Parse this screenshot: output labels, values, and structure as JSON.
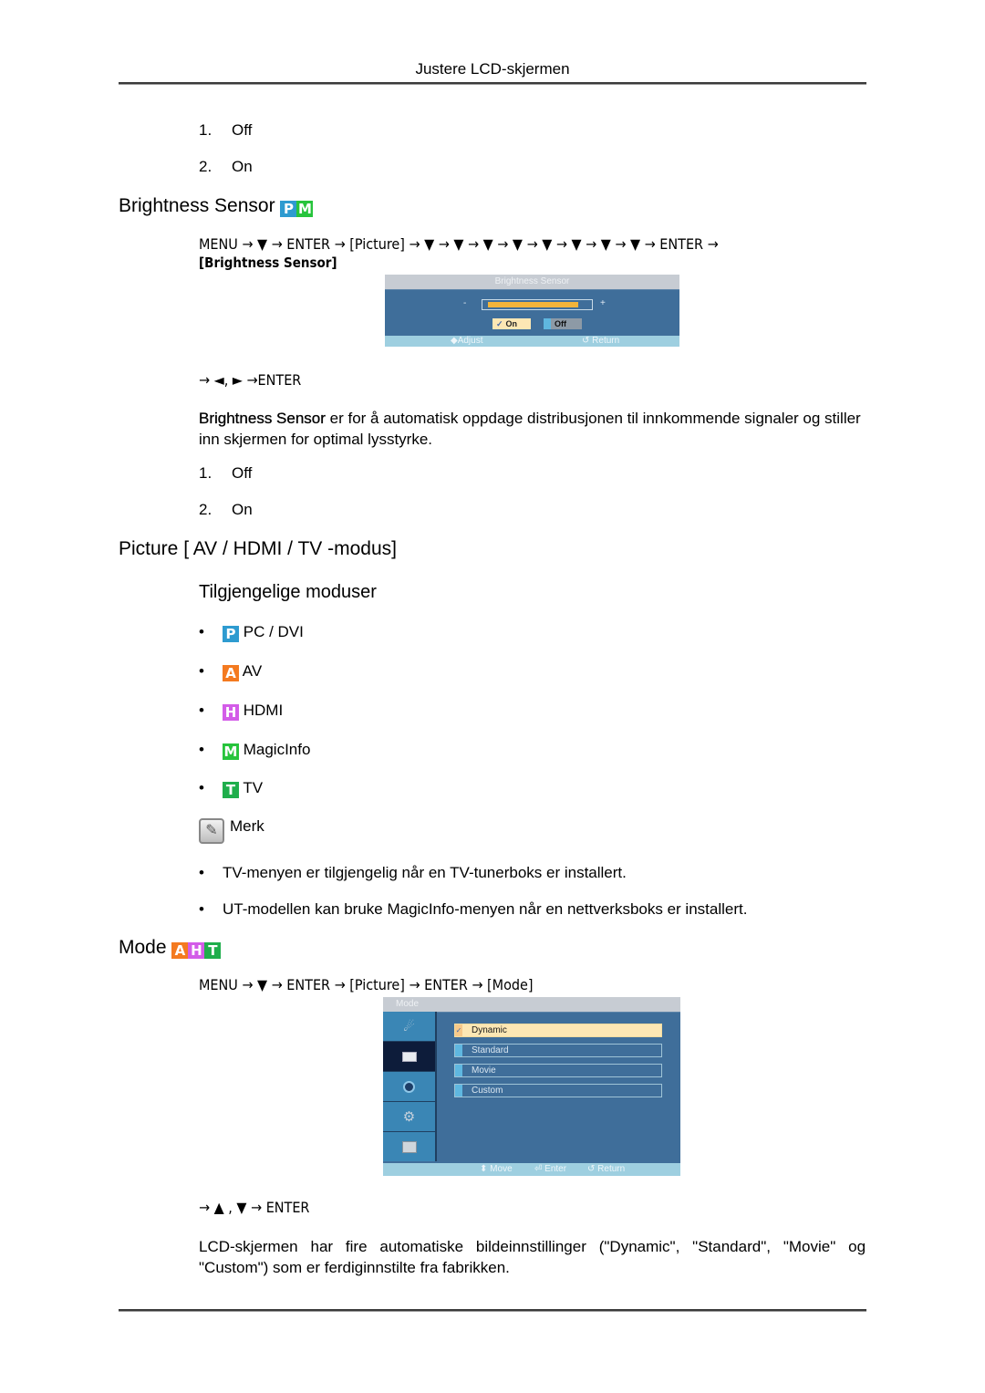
{
  "header": {
    "title": "Justere LCD-skjermen"
  },
  "list_top": [
    {
      "num": "1.",
      "label": "Off"
    },
    {
      "num": "2.",
      "label": "On"
    }
  ],
  "brightness": {
    "heading": "Brightness Sensor",
    "badges": [
      {
        "letter": "P",
        "color": "#2e9bd0"
      },
      {
        "letter": "M",
        "color": "#27c43c"
      }
    ],
    "nav_line1": "MENU → ▼ → ENTER → [Picture] → ▼ → ▼ → ▼ → ▼ → ▼ → ▼ → ▼ → ▼ → ENTER →",
    "nav_line2": "[Brightness Sensor]",
    "osd": {
      "title": "Brightness Sensor",
      "minus": "-",
      "plus": "+",
      "level_fraction": 0.92,
      "on_label": "On",
      "off_label": "Off",
      "selected": "On",
      "footer_adjust": "Adjust",
      "footer_return": "Return"
    },
    "nav_after": "→ ◄, ► →ENTER",
    "desc_bold": "Brightness Sensor",
    "desc_rest": " er for å automatisk oppdage distribusjonen til innkommende signaler og stiller inn skjermen for optimal lysstyrke.",
    "options": [
      {
        "num": "1.",
        "label": "Off"
      },
      {
        "num": "2.",
        "label": "On"
      }
    ]
  },
  "picture_section": {
    "heading": "Picture [ AV / HDMI / TV -modus]",
    "subheading": "Tilgjengelige moduser",
    "modes": [
      {
        "letter": "P",
        "color": "#2e9bd0",
        "label": "PC / DVI"
      },
      {
        "letter": "A",
        "color": "#f47a20",
        "label": "AV"
      },
      {
        "letter": "H",
        "color": "#d35ce8",
        "label": "HDMI"
      },
      {
        "letter": "M",
        "color": "#27c43c",
        "label": "MagicInfo"
      },
      {
        "letter": "T",
        "color": "#1fae4c",
        "label": "TV"
      }
    ],
    "note_label": "Merk",
    "notes": [
      {
        "bold": "TV",
        "rest": "-menyen er tilgjengelig når en TV-tunerboks er installert."
      },
      {
        "pre": "UT-modellen kan bruke ",
        "bold": "MagicInfo",
        "rest": "-menyen når en nettverksboks er installert."
      }
    ]
  },
  "mode_section": {
    "heading": "Mode",
    "badges": [
      {
        "letter": "A",
        "color": "#f47a20"
      },
      {
        "letter": "H",
        "color": "#d35ce8"
      },
      {
        "letter": "T",
        "color": "#1fae4c"
      }
    ],
    "nav": "MENU → ▼ → ENTER → [Picture] → ENTER → [Mode]",
    "osd": {
      "title": "Mode",
      "side_icons": [
        "satellite-dish-icon",
        "picture-icon",
        "sound-icon",
        "setup-gear-icon",
        "input-icon"
      ],
      "selected_side": 1,
      "options": [
        "Dynamic",
        "Standard",
        "Movie",
        "Custom"
      ],
      "selected_option": "Dynamic",
      "footer_move": "Move",
      "footer_enter": "Enter",
      "footer_return": "Return"
    },
    "nav_after": "→ ▲ , ▼ → ENTER",
    "desc": {
      "p1": "LCD-skjermen har fire automatiske bildeinnstillinger (\"",
      "b1": "Dynamic",
      "p2": "\", \"",
      "b2": "Standard",
      "p3": "\", \"",
      "b3": "Movie",
      "p4": "\" og \"",
      "b4": "Custom",
      "p5": "\") som er ferdiginnstilte fra fabrikken."
    }
  }
}
